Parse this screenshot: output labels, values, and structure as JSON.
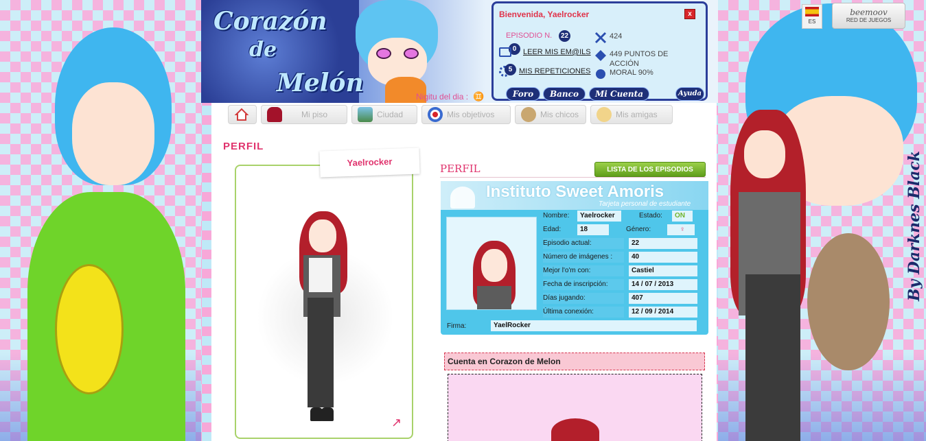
{
  "header": {
    "logo_line1": "Corazón",
    "logo_line2": "de",
    "logo_line3": "Melón",
    "sign_label": "Nigitu del dia :",
    "sign_symbol": "♊"
  },
  "welcome": {
    "title": "Bienvenida, Yaelrocker",
    "close": "x",
    "episode_label": "EPISODIO N.",
    "episode_number": "22",
    "mail_count": "0",
    "mail_link": "LEER MIS EM@ILS",
    "repeat_count": "5",
    "repeat_link": "MIS REPETICIONES",
    "stat_dollars": "424",
    "stat_action": "449 PUNTOS DE ACCIÓN",
    "stat_moral": "MORAL 90%",
    "buttons": [
      "Foro",
      "Banco",
      "Mi Cuenta",
      "Ayuda"
    ]
  },
  "topright": {
    "lang": "ES",
    "partner_logo": "beemoov",
    "partner_sub": "RED DE JUEGOS"
  },
  "nav": {
    "items": [
      "",
      "Mi piso",
      "Ciudad",
      "Mis objetivos",
      "Mis chicos",
      "Mis amigas"
    ]
  },
  "profile": {
    "heading": "PERFIL",
    "name_tab": "Yaelrocker",
    "sub_heading": "PERFIL",
    "episodes_button": "LISTA DE LOS EPISODIOS",
    "card_title": "Instituto Sweet Amoris",
    "card_subtitle": "Tarjeta personal de estudiante",
    "fields": {
      "nombre_label": "Nombre:",
      "nombre": "Yaelrocker",
      "estado_label": "Estado:",
      "estado": "ON",
      "edad_label": "Edad:",
      "edad": "18",
      "genero_label": "Género:",
      "genero_symbol": "♀",
      "episodio_label": "Episodio actual:",
      "episodio": "22",
      "imagenes_label": "Número de imágenes :",
      "imagenes": "40",
      "mejor_label": "Mejor l'o'm con:",
      "mejor": "Castiel",
      "fecha_label": "Fecha de inscripción:",
      "fecha": "14 / 07 / 2013",
      "dias_label": "Días jugando:",
      "dias": "407",
      "ultima_label": "Última conexión:",
      "ultima": "12 / 09 / 2014",
      "firma_label": "Firma:",
      "firma": "YaelRocker"
    },
    "account_heading": "Cuenta en Corazon de Melon"
  },
  "decor": {
    "signature": "By Darknes Black"
  },
  "colors": {
    "accent_pink": "#e0336d",
    "card_blue": "#4fc6ea",
    "nav_green": "#6fb32a",
    "header_navy": "#1e2f78"
  }
}
